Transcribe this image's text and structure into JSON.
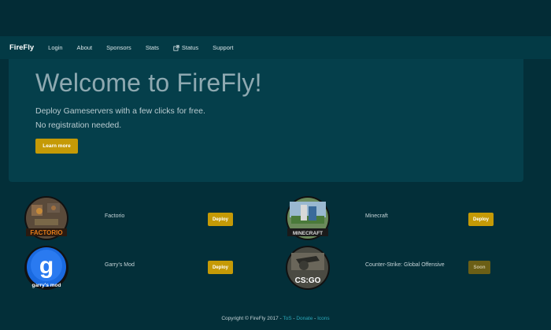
{
  "nav": {
    "brand": "FireFly",
    "items": [
      {
        "label": "Login"
      },
      {
        "label": "About"
      },
      {
        "label": "Sponsors"
      },
      {
        "label": "Stats"
      },
      {
        "label": "Status",
        "icon": "external-link-icon"
      },
      {
        "label": "Support"
      }
    ]
  },
  "hero": {
    "title": "Welcome to FireFly!",
    "line1": "Deploy Gameservers with a few clicks for free.",
    "line2": "No registration needed.",
    "button": "Learn more"
  },
  "games": [
    {
      "name": "Factorio",
      "logo_text": "FACTORIO",
      "button": "Deploy",
      "status": "available"
    },
    {
      "name": "Minecraft",
      "logo_text": "MINECRAFT",
      "button": "Deploy",
      "status": "available"
    },
    {
      "name": "Garry's Mod",
      "logo_text": "garry's mod",
      "button": "Deploy",
      "status": "available"
    },
    {
      "name": "Counter-Strike: Global Offensive",
      "logo_text": "CS:GO",
      "button": "Soon",
      "status": "coming-soon"
    }
  ],
  "footer": {
    "copyright": "Copyright © FireFly 2017 - ",
    "tos": "ToS",
    "sep1": " - ",
    "donate": "Donate",
    "sep2": " - ",
    "icons": "Icons"
  },
  "colors": {
    "background": "#032f39",
    "navbar": "#033a45",
    "jumbotron": "#053f4b",
    "accent": "#c59a06",
    "link": "#2aa7b8"
  }
}
